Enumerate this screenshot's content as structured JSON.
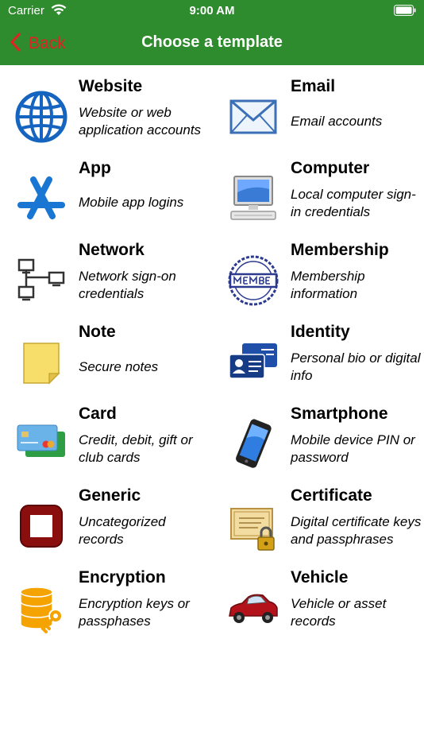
{
  "status_bar": {
    "carrier": "Carrier",
    "time": "9:00 AM"
  },
  "nav": {
    "back_label": "Back",
    "title": "Choose a template"
  },
  "templates": [
    {
      "title": "Website",
      "description": "Website or web application accounts",
      "icon": "globe-icon"
    },
    {
      "title": "Email",
      "description": "Email accounts",
      "icon": "envelope-icon"
    },
    {
      "title": "App",
      "description": "Mobile app logins",
      "icon": "app-store-icon"
    },
    {
      "title": "Computer",
      "description": "Local computer sign-in credentials",
      "icon": "computer-icon"
    },
    {
      "title": "Network",
      "description": "Network sign-on credentials",
      "icon": "network-icon"
    },
    {
      "title": "Membership",
      "description": "Membership information",
      "icon": "member-stamp-icon"
    },
    {
      "title": "Note",
      "description": "Secure notes",
      "icon": "sticky-note-icon"
    },
    {
      "title": "Identity",
      "description": "Personal bio or digital info",
      "icon": "id-card-icon"
    },
    {
      "title": "Card",
      "description": "Credit, debit, gift or club cards",
      "icon": "credit-card-icon"
    },
    {
      "title": "Smartphone",
      "description": "Mobile device PIN or password",
      "icon": "smartphone-icon"
    },
    {
      "title": "Generic",
      "description": "Uncategorized records",
      "icon": "generic-stop-icon"
    },
    {
      "title": "Certificate",
      "description": "Digital certificate keys and passphrases",
      "icon": "certificate-icon"
    },
    {
      "title": "Encryption",
      "description": "Encryption keys or passphases",
      "icon": "database-key-icon"
    },
    {
      "title": "Vehicle",
      "description": "Vehicle or asset records",
      "icon": "car-icon"
    }
  ]
}
